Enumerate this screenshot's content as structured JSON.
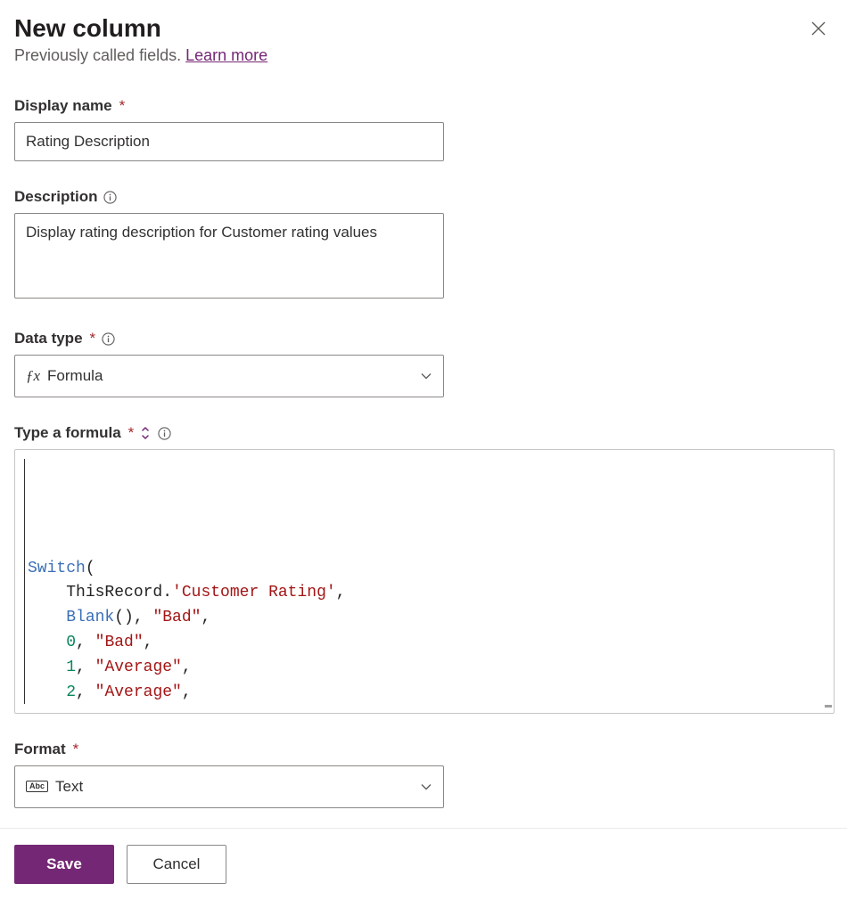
{
  "header": {
    "title": "New column",
    "subtitle_pre": "Previously called fields. ",
    "learn_more": "Learn more"
  },
  "fields": {
    "display_name": {
      "label": "Display name",
      "required": "*",
      "value": "Rating Description"
    },
    "description": {
      "label": "Description",
      "value": "Display rating description for Customer rating values"
    },
    "data_type": {
      "label": "Data type",
      "required": "*",
      "value": "Formula",
      "icon": "fx"
    },
    "formula": {
      "label": "Type a formula",
      "required": "*",
      "tokens": [
        {
          "t": "fn",
          "v": "Switch"
        },
        {
          "t": "plain",
          "v": "("
        },
        {
          "t": "nl"
        },
        {
          "t": "indent"
        },
        {
          "t": "plain",
          "v": "ThisRecord."
        },
        {
          "t": "str",
          "v": "'Customer Rating'"
        },
        {
          "t": "plain",
          "v": ","
        },
        {
          "t": "nl"
        },
        {
          "t": "indent"
        },
        {
          "t": "fn",
          "v": "Blank"
        },
        {
          "t": "plain",
          "v": "(), "
        },
        {
          "t": "str",
          "v": "\"Bad\""
        },
        {
          "t": "plain",
          "v": ","
        },
        {
          "t": "nl"
        },
        {
          "t": "indent"
        },
        {
          "t": "num",
          "v": "0"
        },
        {
          "t": "plain",
          "v": ", "
        },
        {
          "t": "str",
          "v": "\"Bad\""
        },
        {
          "t": "plain",
          "v": ","
        },
        {
          "t": "nl"
        },
        {
          "t": "indent"
        },
        {
          "t": "num",
          "v": "1"
        },
        {
          "t": "plain",
          "v": ", "
        },
        {
          "t": "str",
          "v": "\"Average\""
        },
        {
          "t": "plain",
          "v": ","
        },
        {
          "t": "nl"
        },
        {
          "t": "indent"
        },
        {
          "t": "num",
          "v": "2"
        },
        {
          "t": "plain",
          "v": ", "
        },
        {
          "t": "str",
          "v": "\"Average\""
        },
        {
          "t": "plain",
          "v": ","
        }
      ]
    },
    "format": {
      "label": "Format",
      "required": "*",
      "value": "Text",
      "icon": "Abc"
    }
  },
  "footer": {
    "save": "Save",
    "cancel": "Cancel"
  }
}
